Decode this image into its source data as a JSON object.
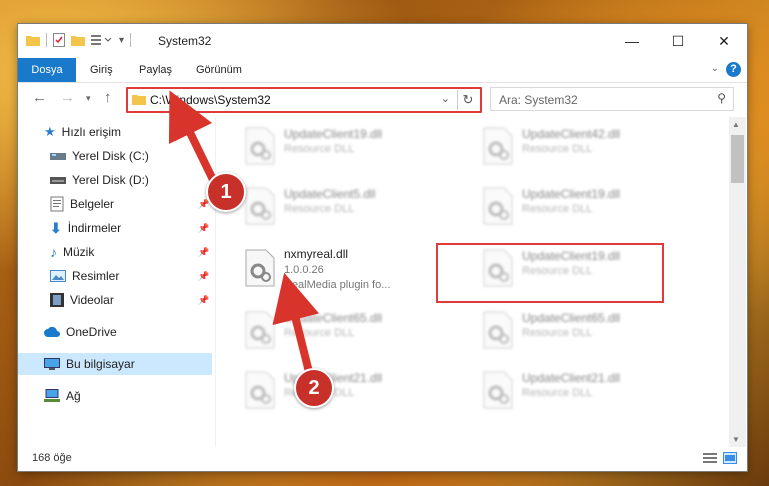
{
  "window": {
    "title": "System32"
  },
  "ribbon": {
    "tabs": [
      "Dosya",
      "Giriş",
      "Paylaş",
      "Görünüm"
    ]
  },
  "address": {
    "path": "C:\\Windows\\System32"
  },
  "search": {
    "placeholder": "Ara: System32"
  },
  "nav": {
    "items": [
      {
        "label": "Hızlı erişim",
        "icon": "star-icon"
      },
      {
        "label": "Yerel Disk (C:)",
        "icon": "drive-icon"
      },
      {
        "label": "Yerel Disk (D:)",
        "icon": "drive-icon"
      },
      {
        "label": "Belgeler",
        "icon": "documents-icon"
      },
      {
        "label": "İndirmeler",
        "icon": "download-icon"
      },
      {
        "label": "Müzik",
        "icon": "music-icon"
      },
      {
        "label": "Resimler",
        "icon": "pictures-icon"
      },
      {
        "label": "Videolar",
        "icon": "video-icon"
      },
      {
        "label": "OneDrive",
        "icon": "cloud-icon"
      },
      {
        "label": "Bu bilgisayar",
        "icon": "computer-icon"
      },
      {
        "label": "Ağ",
        "icon": "network-icon"
      }
    ]
  },
  "files": {
    "left": [
      {
        "name": "UpdateClient19.dll",
        "desc": "Resource DLL"
      },
      {
        "name": "UpdateClient5.dll",
        "desc": "Resource DLL"
      },
      {
        "name": "nxmyreal.dll",
        "version": "1.0.0.26",
        "desc": "RealMedia plugin fo..."
      },
      {
        "name": "UpdateClient65.dll",
        "desc": "Resource DLL"
      },
      {
        "name": "UpdateClient21.dll",
        "desc": "Resource DLL"
      }
    ],
    "right": [
      {
        "name": "UpdateClient42.dll",
        "desc": "Resource DLL"
      },
      {
        "name": "UpdateClient19.dll",
        "desc": "Resource DLL"
      },
      {
        "name": "UpdateClient19.dll",
        "desc": "Resource DLL"
      },
      {
        "name": "UpdateClient65.dll",
        "desc": "Resource DLL"
      },
      {
        "name": "UpdateClient21.dll",
        "desc": "Resource DLL"
      }
    ]
  },
  "status": {
    "count": "168 öğe"
  },
  "callouts": {
    "one": "1",
    "two": "2"
  },
  "colors": {
    "accent": "#1979ca",
    "highlight": "#e03a3a",
    "callout": "#c8302a"
  }
}
